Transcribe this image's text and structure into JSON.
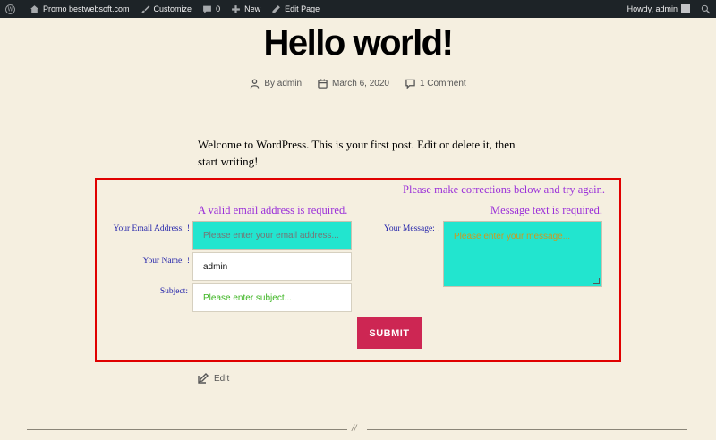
{
  "adminbar": {
    "site": "Promo bestwebsoft.com",
    "customize": "Customize",
    "comments_count": "0",
    "new": "New",
    "edit_page": "Edit Page",
    "howdy": "Howdy, admin"
  },
  "post": {
    "title": "Hello world!",
    "author": "By admin",
    "date": "March 6, 2020",
    "comments": "1 Comment",
    "intro": "Welcome to WordPress. This is your first post. Edit or delete it, then start writing!",
    "edit": "Edit",
    "separator": "//"
  },
  "form": {
    "general_error": "Please make corrections below and try again.",
    "email_error": "A valid email address is required.",
    "message_error": "Message text is required.",
    "email_label": "Your Email Address:",
    "name_label": "Your Name:",
    "subject_label": "Subject:",
    "message_label": "Your Message:",
    "required_mark": "!",
    "email_placeholder": "Please enter your email address...",
    "name_value": "admin",
    "subject_placeholder": "Please enter subject...",
    "message_placeholder": "Please enter your message...",
    "submit": "SUBMIT"
  },
  "colors": {
    "error_text": "#9b30d9",
    "invalid_field": "#22e5cf",
    "submit": "#cd2653",
    "form_border": "#e00000"
  }
}
